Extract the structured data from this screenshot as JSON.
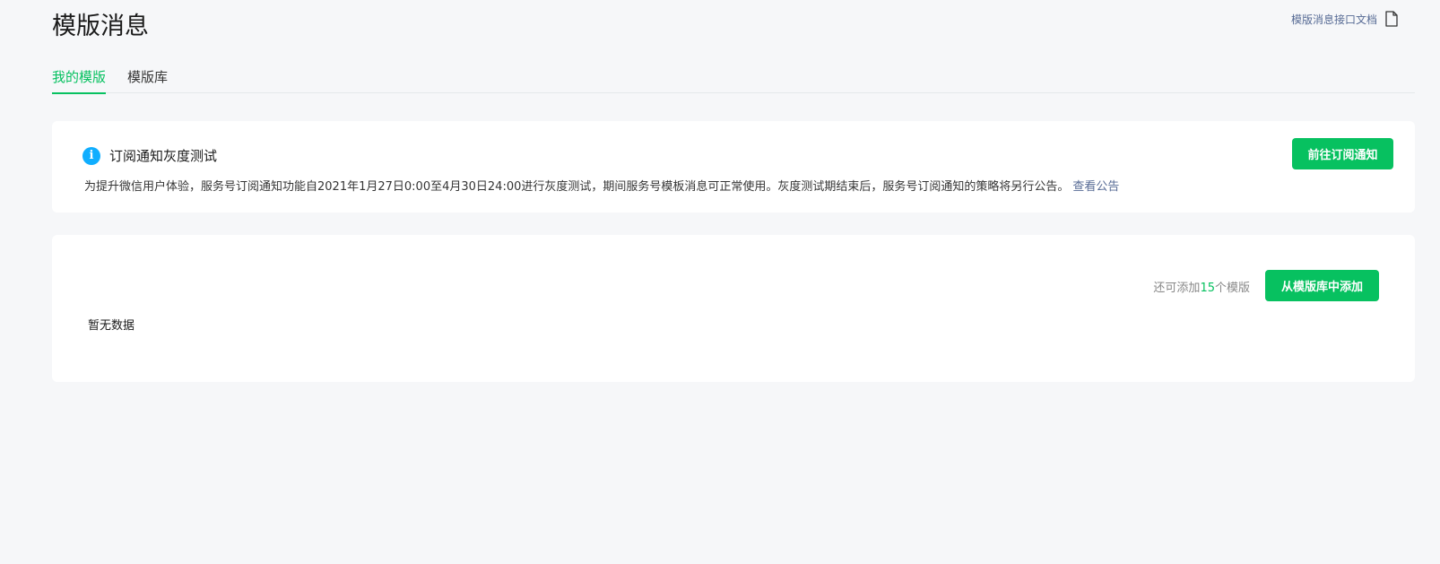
{
  "header": {
    "title": "模版消息",
    "doc_link_label": "模版消息接口文档",
    "doc_icon": "document-icon"
  },
  "tabs": [
    {
      "label": "我的模版",
      "active": true
    },
    {
      "label": "模版库",
      "active": false
    }
  ],
  "notice": {
    "icon": "info-icon",
    "icon_glyph": "i",
    "title": "订阅通知灰度测试",
    "body": "为提升微信用户体验，服务号订阅通知功能自2021年1月27日0:00至4月30日24:00进行灰度测试，期间服务号模板消息可正常使用。灰度测试期结束后，服务号订阅通知的策略将另行公告。",
    "link_label": "查看公告",
    "button_label": "前往订阅通知"
  },
  "templates": {
    "remaining_prefix": "还可添加",
    "remaining_count": "15",
    "remaining_suffix": "个模版",
    "add_button_label": "从模版库中添加",
    "empty_text": "暂无数据"
  },
  "colors": {
    "accent": "#07c160",
    "link": "#576b95",
    "info": "#10aeff",
    "background": "#f6f7f9"
  }
}
